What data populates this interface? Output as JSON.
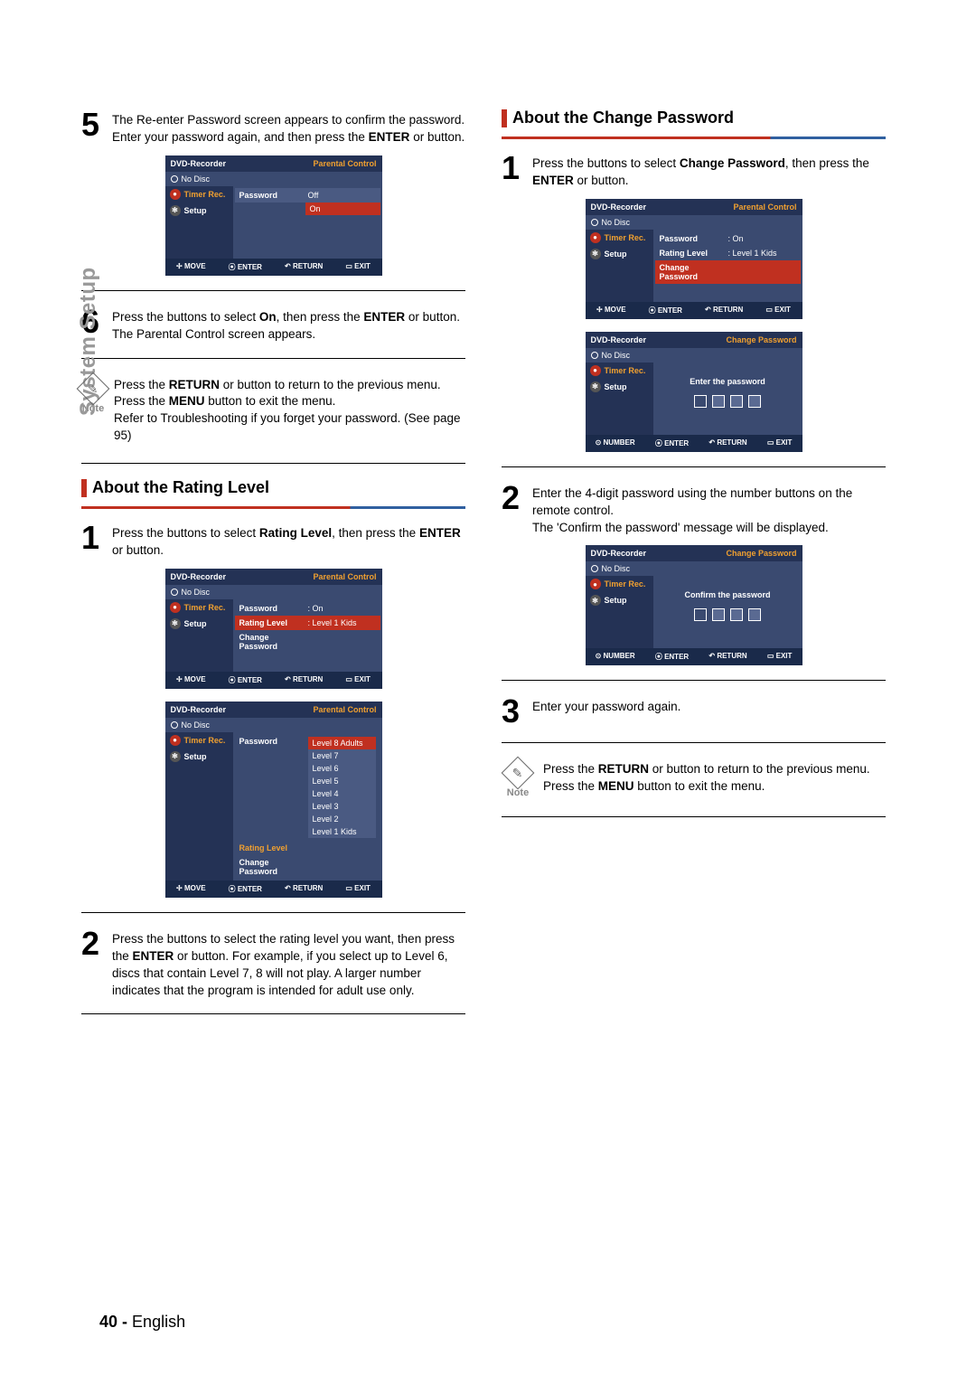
{
  "side_tab": "System Setup",
  "page_footer": {
    "num": "40 -",
    "lang": "English"
  },
  "col1": {
    "step5_num": "5",
    "step5_text_a": "The Re-enter Password screen appears to confirm the password. Enter your password again, and then press the ",
    "step5_enter": "ENTER",
    "step5_text_b": " or      button.",
    "step6_num": "6",
    "step6_a": "Press the        buttons to select ",
    "step6_on": "On",
    "step6_b": ", then press the ",
    "step6_enter": "ENTER",
    "step6_c": " or      button.",
    "step6_d": "The Parental Control screen appears.",
    "note1_a": "Press the ",
    "note1_return": "RETURN",
    "note1_b": " or      button to return to the previous menu. Press the ",
    "note1_menu": "MENU",
    "note1_c": " button to exit the menu.",
    "note1_d": "Refer to Troubleshooting if you forget your password. (See page 95)",
    "heading1": "About the Rating Level",
    "r_step1_num": "1",
    "r_step1_a": "Press the        buttons to select ",
    "r_step1_bold": "Rating Level",
    "r_step1_b": ", then press the ",
    "r_step1_enter": "ENTER",
    "r_step1_c": " or      button.",
    "r_step2_num": "2",
    "r_step2_a": "Press the        buttons to select the rating level you want, then press the ",
    "r_step2_enter": "ENTER",
    "r_step2_b": " or      button. For example, if you select up to Level 6, discs that contain Level 7, 8 will not play. A larger number indicates that the program is intended for adult use only."
  },
  "col2": {
    "heading2": "About the Change Password",
    "c_step1_num": "1",
    "c_step1_a": "Press the        buttons to select ",
    "c_step1_bold": "Change Password",
    "c_step1_b": ", then press the ",
    "c_step1_enter": "ENTER",
    "c_step1_c": " or      button.",
    "c_step2_num": "2",
    "c_step2_a": "Enter the 4-digit password using the number buttons on the remote control.",
    "c_step2_b": "The 'Confirm the password' message will be displayed.",
    "c_step3_num": "3",
    "c_step3_a": "Enter your password again.",
    "note2_a": "Press the ",
    "note2_return": "RETURN",
    "note2_b": " or      button to return to the previous menu.",
    "note2_c": "Press the ",
    "note2_menu": "MENU",
    "note2_d": " button to exit the menu."
  },
  "osd_common": {
    "title": "DVD-Recorder",
    "parental": "Parental Control",
    "change_pw": "Change Password",
    "nodisc": "No Disc",
    "timer": "Timer Rec.",
    "setup": "Setup",
    "password": "Password",
    "rating": "Rating Level",
    "changepw": "Change Password",
    "on": ": On",
    "off": "Off",
    "on_lone": "On",
    "l1kids": ": Level 1 Kids",
    "move": "MOVE",
    "enter": "ENTER",
    "return": "RETURN",
    "exit": "EXIT",
    "number": "NUMBER",
    "enter_pw": "Enter the password",
    "confirm_pw": "Confirm the password",
    "levels": [
      "Level 8 Adults",
      "Level 7",
      "Level 6",
      "Level 5",
      "Level 4",
      "Level 3",
      "Level 2",
      "Level 1 Kids"
    ]
  },
  "note_label": "Note"
}
